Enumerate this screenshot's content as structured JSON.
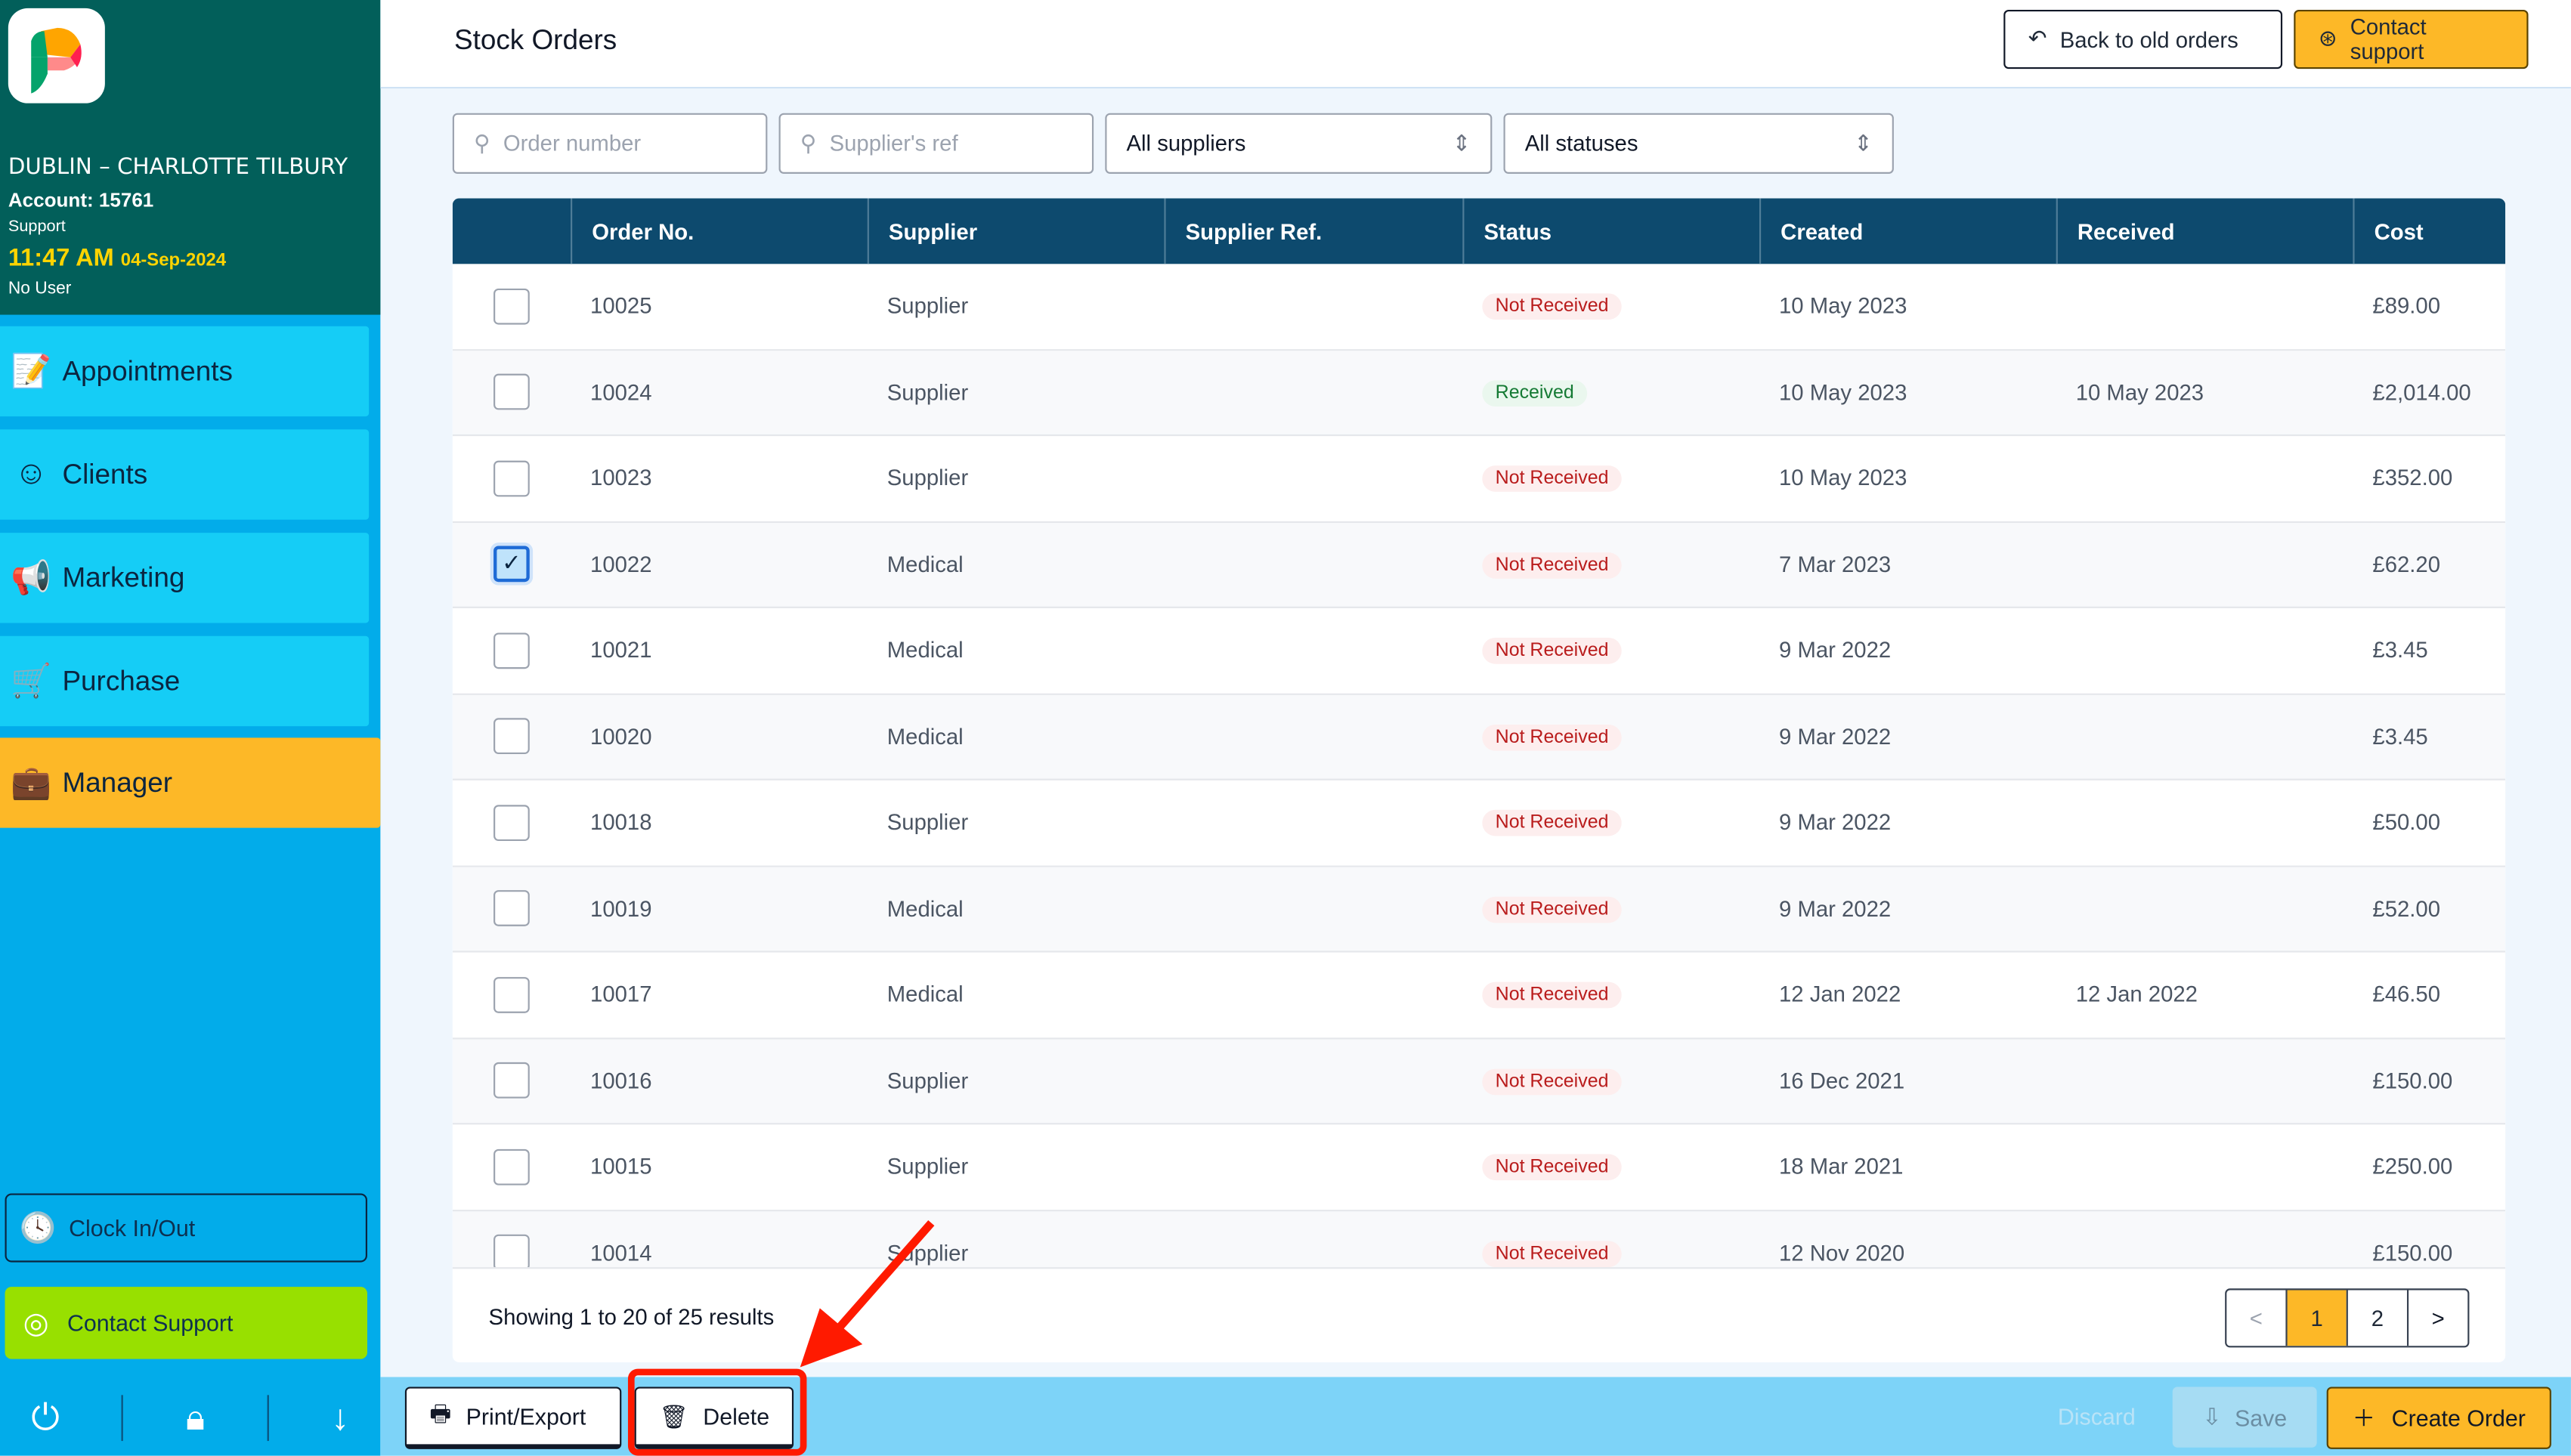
{
  "sidebar": {
    "location": "DUBLIN – CHARLOTTE TILBURY",
    "account": "Account: 15761",
    "role": "Support",
    "time": "11:47 AM",
    "date": "04-Sep-2024",
    "user": "No User",
    "nav": [
      {
        "label": "Appointments",
        "icon": "calendar-edit-icon"
      },
      {
        "label": "Clients",
        "icon": "client-head-icon"
      },
      {
        "label": "Marketing",
        "icon": "megaphone-icon"
      },
      {
        "label": "Purchase",
        "icon": "cart-icon"
      },
      {
        "label": "Manager",
        "icon": "briefcase-icon",
        "active": true
      }
    ],
    "clock_label": "Clock In/Out",
    "support_label": "Contact Support"
  },
  "header": {
    "title": "Stock Orders",
    "back_label": "Back to old orders",
    "support_label": "Contact support"
  },
  "filters": {
    "order_placeholder": "Order number",
    "ref_placeholder": "Supplier's ref",
    "supplier_value": "All suppliers",
    "status_value": "All statuses"
  },
  "table": {
    "columns": [
      "Order No.",
      "Supplier",
      "Supplier Ref.",
      "Status",
      "Created",
      "Received",
      "Cost"
    ],
    "rows": [
      {
        "no": "10025",
        "supplier": "Supplier",
        "ref": "",
        "status": "Not Received",
        "created": "10 May 2023",
        "received": "",
        "cost": "£89.00",
        "checked": false
      },
      {
        "no": "10024",
        "supplier": "Supplier",
        "ref": "",
        "status": "Received",
        "created": "10 May 2023",
        "received": "10 May 2023",
        "cost": "£2,014.00",
        "checked": false
      },
      {
        "no": "10023",
        "supplier": "Supplier",
        "ref": "",
        "status": "Not Received",
        "created": "10 May 2023",
        "received": "",
        "cost": "£352.00",
        "checked": false
      },
      {
        "no": "10022",
        "supplier": "Medical",
        "ref": "",
        "status": "Not Received",
        "created": "7 Mar 2023",
        "received": "",
        "cost": "£62.20",
        "checked": true
      },
      {
        "no": "10021",
        "supplier": "Medical",
        "ref": "",
        "status": "Not Received",
        "created": "9 Mar 2022",
        "received": "",
        "cost": "£3.45",
        "checked": false
      },
      {
        "no": "10020",
        "supplier": "Medical",
        "ref": "",
        "status": "Not Received",
        "created": "9 Mar 2022",
        "received": "",
        "cost": "£3.45",
        "checked": false
      },
      {
        "no": "10018",
        "supplier": "Supplier",
        "ref": "",
        "status": "Not Received",
        "created": "9 Mar 2022",
        "received": "",
        "cost": "£50.00",
        "checked": false
      },
      {
        "no": "10019",
        "supplier": "Medical",
        "ref": "",
        "status": "Not Received",
        "created": "9 Mar 2022",
        "received": "",
        "cost": "£52.00",
        "checked": false
      },
      {
        "no": "10017",
        "supplier": "Medical",
        "ref": "",
        "status": "Not Received",
        "created": "12 Jan 2022",
        "received": "12 Jan 2022",
        "cost": "£46.50",
        "checked": false
      },
      {
        "no": "10016",
        "supplier": "Supplier",
        "ref": "",
        "status": "Not Received",
        "created": "16 Dec 2021",
        "received": "",
        "cost": "£150.00",
        "checked": false
      },
      {
        "no": "10015",
        "supplier": "Supplier",
        "ref": "",
        "status": "Not Received",
        "created": "18 Mar 2021",
        "received": "",
        "cost": "£250.00",
        "checked": false
      },
      {
        "no": "10014",
        "supplier": "Supplier",
        "ref": "",
        "status": "Not Received",
        "created": "12 Nov 2020",
        "received": "",
        "cost": "£150.00",
        "checked": false
      }
    ]
  },
  "pagination": {
    "summary": "Showing 1 to 20 of 25 results",
    "pages": [
      "1",
      "2"
    ],
    "current": "1"
  },
  "actions": {
    "print_label": "Print/Export",
    "delete_label": "Delete",
    "discard_label": "Discard",
    "save_label": "Save",
    "create_label": "Create Order"
  },
  "colors": {
    "sidebar_top": "#025f5a",
    "sidebar": "#02acea",
    "nav": "#15cdf6",
    "active": "#fdb827",
    "table_header": "#0d4a6e",
    "annotation": "#ff1a00"
  }
}
